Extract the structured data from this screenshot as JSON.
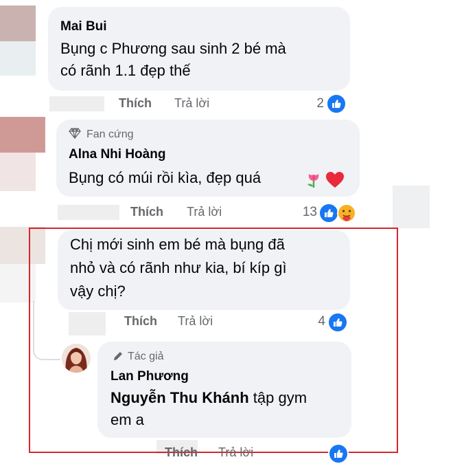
{
  "comments": [
    {
      "author": "Mai Bui",
      "lines": [
        "Bụng c Phương sau sinh 2 bé mà",
        "có rãnh 1.1 đẹp thế"
      ],
      "like_label": "Thích",
      "reply_label": "Trả lời",
      "reaction_count": "2"
    },
    {
      "badge": "Fan cứng",
      "author": "Alna Nhi Hoàng",
      "text": "Bụng có múi rồi kìa, đẹp quá",
      "like_label": "Thích",
      "reply_label": "Trả lời",
      "reaction_count": "13"
    },
    {
      "lines": [
        "Chị mới sinh em bé mà bụng đã",
        "nhỏ và có rãnh như kia, bí kíp gì",
        "vậy chị?"
      ],
      "like_label": "Thích",
      "reply_label": "Trả lời",
      "reaction_count": "4"
    },
    {
      "badge": "Tác giả",
      "author": "Lan Phương",
      "mention": "Nguyễn Thu Khánh",
      "line1_rest": " tập gym",
      "line2": "em a",
      "like_label": "Thích",
      "reply_label": "Trả lời"
    }
  ],
  "colors": {
    "bubble": "#f0f2f5",
    "highlight_border": "#d6252b",
    "like_blue": "#1877f2",
    "meta_gray": "#65676b"
  }
}
